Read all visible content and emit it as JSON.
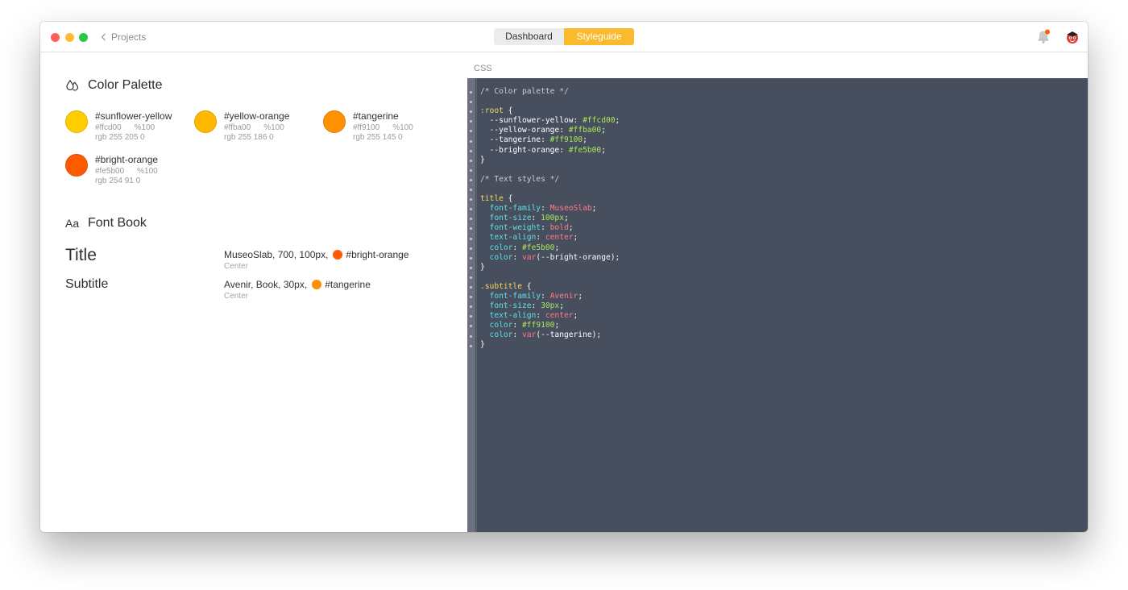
{
  "titlebar": {
    "back_label": "Projects",
    "tabs": [
      {
        "label": "Dashboard",
        "active": false
      },
      {
        "label": "Styleguide",
        "active": true
      }
    ],
    "accent_color": "#fbb92c"
  },
  "palette": {
    "title": "Color Palette",
    "icon": "drops-icon",
    "swatches": [
      {
        "name": "#sunflower-yellow",
        "hex": "#ffcd00",
        "opacity": "%100",
        "rgb": "rgb 255 205 0",
        "color": "#ffcd00"
      },
      {
        "name": "#yellow-orange",
        "hex": "#ffba00",
        "opacity": "%100",
        "rgb": "rgb 255 186 0",
        "color": "#ffba00"
      },
      {
        "name": "#tangerine",
        "hex": "#ff9100",
        "opacity": "%100",
        "rgb": "rgb 255 145 0",
        "color": "#ff9100"
      },
      {
        "name": "#bright-orange",
        "hex": "#fe5b00",
        "opacity": "%100",
        "rgb": "rgb 254 91 0",
        "color": "#fe5b00"
      }
    ]
  },
  "fontbook": {
    "icon_label": "Aa",
    "title": "Font Book",
    "fonts": [
      {
        "name": "Title",
        "spec": "MuseoSlab, 700, 100px,",
        "color_name": "#bright-orange",
        "color": "#fe5b00",
        "align": "Center"
      },
      {
        "name": "Subtitle",
        "spec": "Avenir, Book, 30px,",
        "color_name": "#tangerine",
        "color": "#ff9100",
        "align": "Center"
      }
    ]
  },
  "editor": {
    "tab_label": "CSS",
    "lines": [
      [
        {
          "t": "/* Color palette */",
          "c": "c-com"
        }
      ],
      [],
      [
        {
          "t": ":root",
          "c": "c-sel"
        },
        {
          "t": " {",
          "c": "c-plain"
        }
      ],
      [
        {
          "t": "  --sunflower-yellow",
          "c": "c-var"
        },
        {
          "t": ": ",
          "c": "c-plain"
        },
        {
          "t": "#ffcd00",
          "c": "c-val"
        },
        {
          "t": ";",
          "c": "c-plain"
        }
      ],
      [
        {
          "t": "  --yellow-orange",
          "c": "c-var"
        },
        {
          "t": ": ",
          "c": "c-plain"
        },
        {
          "t": "#ffba00",
          "c": "c-val"
        },
        {
          "t": ";",
          "c": "c-plain"
        }
      ],
      [
        {
          "t": "  --tangerine",
          "c": "c-var"
        },
        {
          "t": ": ",
          "c": "c-plain"
        },
        {
          "t": "#ff9100",
          "c": "c-val"
        },
        {
          "t": ";",
          "c": "c-plain"
        }
      ],
      [
        {
          "t": "  --bright-orange",
          "c": "c-var"
        },
        {
          "t": ": ",
          "c": "c-plain"
        },
        {
          "t": "#fe5b00",
          "c": "c-val"
        },
        {
          "t": ";",
          "c": "c-plain"
        }
      ],
      [
        {
          "t": "}",
          "c": "c-plain"
        }
      ],
      [],
      [
        {
          "t": "/* Text styles */",
          "c": "c-com"
        }
      ],
      [],
      [
        {
          "t": "title",
          "c": "c-sel"
        },
        {
          "t": " {",
          "c": "c-plain"
        }
      ],
      [
        {
          "t": "  font-family",
          "c": "c-prop"
        },
        {
          "t": ": ",
          "c": "c-plain"
        },
        {
          "t": "MuseoSlab",
          "c": "c-kw"
        },
        {
          "t": ";",
          "c": "c-plain"
        }
      ],
      [
        {
          "t": "  font-size",
          "c": "c-prop"
        },
        {
          "t": ": ",
          "c": "c-plain"
        },
        {
          "t": "100px",
          "c": "c-val"
        },
        {
          "t": ";",
          "c": "c-plain"
        }
      ],
      [
        {
          "t": "  font-weight",
          "c": "c-prop"
        },
        {
          "t": ": ",
          "c": "c-plain"
        },
        {
          "t": "bold",
          "c": "c-kw"
        },
        {
          "t": ";",
          "c": "c-plain"
        }
      ],
      [
        {
          "t": "  text-align",
          "c": "c-prop"
        },
        {
          "t": ": ",
          "c": "c-plain"
        },
        {
          "t": "center",
          "c": "c-kw"
        },
        {
          "t": ";",
          "c": "c-plain"
        }
      ],
      [
        {
          "t": "  color",
          "c": "c-prop"
        },
        {
          "t": ": ",
          "c": "c-plain"
        },
        {
          "t": "#fe5b00",
          "c": "c-val"
        },
        {
          "t": ";",
          "c": "c-plain"
        }
      ],
      [
        {
          "t": "  color",
          "c": "c-prop"
        },
        {
          "t": ": ",
          "c": "c-plain"
        },
        {
          "t": "var",
          "c": "c-kw"
        },
        {
          "t": "(--bright-orange);",
          "c": "c-plain"
        }
      ],
      [
        {
          "t": "}",
          "c": "c-plain"
        }
      ],
      [],
      [
        {
          "t": ".subtitle",
          "c": "c-sel"
        },
        {
          "t": " {",
          "c": "c-plain"
        }
      ],
      [
        {
          "t": "  font-family",
          "c": "c-prop"
        },
        {
          "t": ": ",
          "c": "c-plain"
        },
        {
          "t": "Avenir",
          "c": "c-kw"
        },
        {
          "t": ";",
          "c": "c-plain"
        }
      ],
      [
        {
          "t": "  font-size",
          "c": "c-prop"
        },
        {
          "t": ": ",
          "c": "c-plain"
        },
        {
          "t": "30px",
          "c": "c-val"
        },
        {
          "t": ";",
          "c": "c-plain"
        }
      ],
      [
        {
          "t": "  text-align",
          "c": "c-prop"
        },
        {
          "t": ": ",
          "c": "c-plain"
        },
        {
          "t": "center",
          "c": "c-kw"
        },
        {
          "t": ";",
          "c": "c-plain"
        }
      ],
      [
        {
          "t": "  color",
          "c": "c-prop"
        },
        {
          "t": ": ",
          "c": "c-plain"
        },
        {
          "t": "#ff9100",
          "c": "c-val"
        },
        {
          "t": ";",
          "c": "c-plain"
        }
      ],
      [
        {
          "t": "  color",
          "c": "c-prop"
        },
        {
          "t": ": ",
          "c": "c-plain"
        },
        {
          "t": "var",
          "c": "c-kw"
        },
        {
          "t": "(--tangerine);",
          "c": "c-plain"
        }
      ],
      [
        {
          "t": "}",
          "c": "c-plain"
        }
      ]
    ]
  }
}
